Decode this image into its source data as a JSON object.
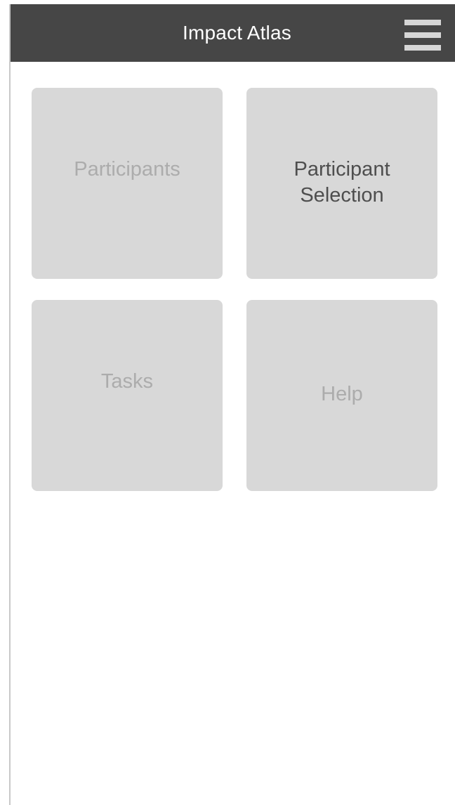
{
  "app": {
    "title": "Impact Atlas",
    "menu_icon": "hamburger-menu-icon"
  },
  "tiles": [
    {
      "label": "Participants",
      "state": "disabled"
    },
    {
      "label_lines": [
        "Participant",
        "Selection"
      ],
      "state": "active"
    },
    {
      "label": "Tasks",
      "state": "disabled"
    },
    {
      "label": "Help",
      "state": "disabled"
    }
  ],
  "colors": {
    "header_bg": "#464646",
    "header_text": "#ffffff",
    "menu_icon": "#d6d6d6",
    "tile_bg": "#d8d8d8",
    "tile_text_active": "#4e4e4e",
    "tile_text_disabled": "#acacac",
    "background": "#ffffff"
  }
}
